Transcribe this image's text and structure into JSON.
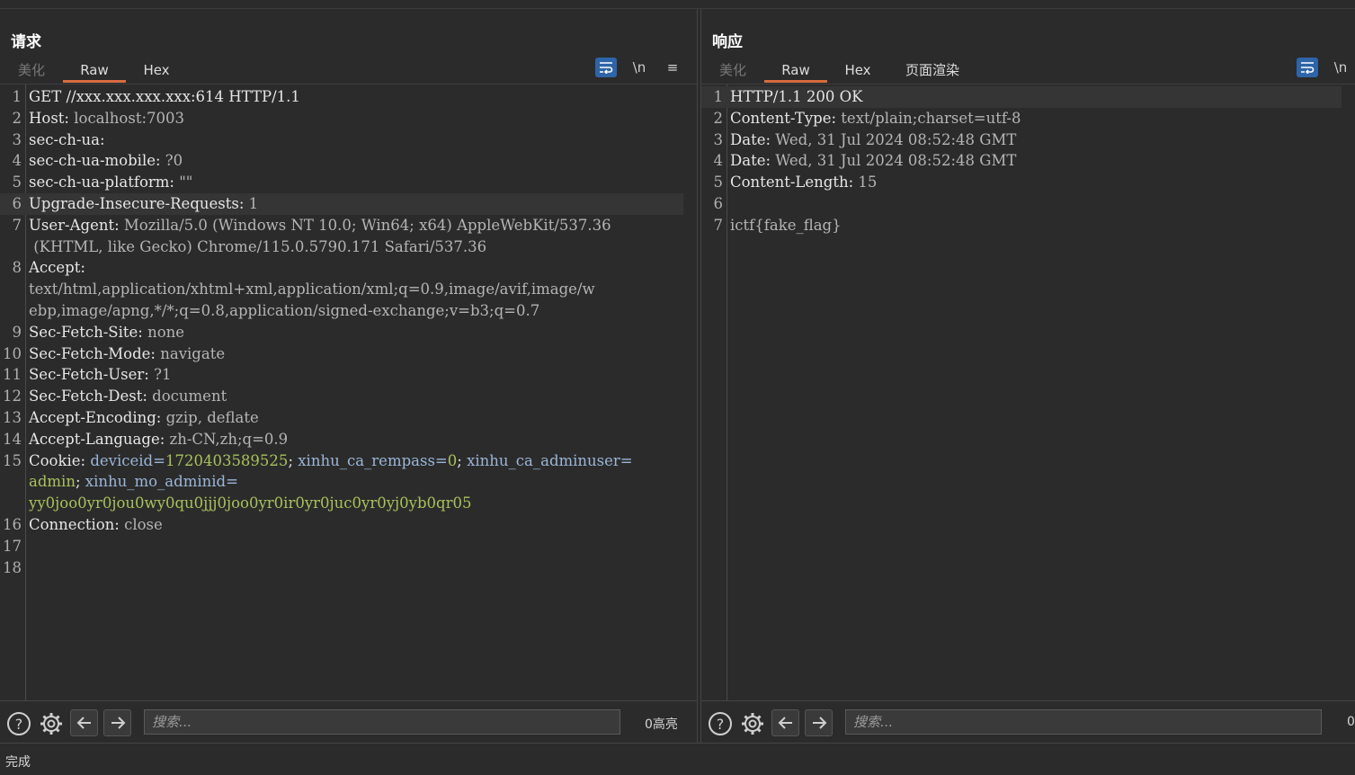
{
  "request": {
    "title": "请求",
    "tabs": [
      "美化",
      "Raw",
      "Hex"
    ],
    "toolbar": {
      "newline": "\\n",
      "menu": "≡"
    },
    "lines": [
      {
        "n": "1",
        "k": "GET //xxx.xxx.xxx.xxx:614 HTTP/1.1",
        "v": ""
      },
      {
        "n": "2",
        "k": "Host: ",
        "v": "localhost:7003"
      },
      {
        "n": "3",
        "k": "sec-ch-ua:",
        "v": ""
      },
      {
        "n": "4",
        "k": "sec-ch-ua-mobile: ",
        "v": "?0"
      },
      {
        "n": "5",
        "k": "sec-ch-ua-platform: ",
        "v": "\"\""
      },
      {
        "n": "6",
        "k": "Upgrade-Insecure-Requests: ",
        "v": "1"
      },
      {
        "n": "7",
        "k": "User-Agent: ",
        "v": "Mozilla/5.0 (Windows NT 10.0; Win64; x64) AppleWebKit/537.36"
      },
      {
        "n": "",
        "k": "",
        "v": " (KHTML, like Gecko) Chrome/115.0.5790.171 Safari/537.36"
      },
      {
        "n": "8",
        "k": "Accept:",
        "v": ""
      },
      {
        "n": "",
        "k": "",
        "v": "text/html,application/xhtml+xml,application/xml;q=0.9,image/avif,image/w"
      },
      {
        "n": "",
        "k": "",
        "v": "ebp,image/apng,*/*;q=0.8,application/signed-exchange;v=b3;q=0.7"
      },
      {
        "n": "9",
        "k": "Sec-Fetch-Site: ",
        "v": "none"
      },
      {
        "n": "10",
        "k": "Sec-Fetch-Mode: ",
        "v": "navigate"
      },
      {
        "n": "11",
        "k": "Sec-Fetch-User: ",
        "v": "?1"
      },
      {
        "n": "12",
        "k": "Sec-Fetch-Dest: ",
        "v": "document"
      },
      {
        "n": "13",
        "k": "Accept-Encoding: ",
        "v": "gzip, deflate"
      },
      {
        "n": "14",
        "k": "Accept-Language: ",
        "v": "zh-CN,zh;q=0.9"
      },
      {
        "n": "15",
        "cookie": [
          [
            "k",
            "Cookie: "
          ],
          [
            "ck",
            "deviceid="
          ],
          [
            "cv",
            "1720403589525"
          ],
          [
            "k",
            "; "
          ],
          [
            "ck",
            "xinhu_ca_rempass="
          ],
          [
            "cv",
            "0"
          ],
          [
            "k",
            "; "
          ],
          [
            "ck",
            "xinhu_ca_adminuser="
          ]
        ]
      },
      {
        "n": "",
        "cookie": [
          [
            "cv",
            "admin"
          ],
          [
            "k",
            "; "
          ],
          [
            "ck",
            "xinhu_mo_adminid="
          ]
        ]
      },
      {
        "n": "",
        "cookie": [
          [
            "cv",
            "yy0joo0yr0jou0wy0qu0jjj0joo0yr0ir0yr0juc0yr0yj0yb0qr05"
          ]
        ]
      },
      {
        "n": "16",
        "k": "Connection: ",
        "v": "close"
      },
      {
        "n": "17",
        "k": "",
        "v": ""
      },
      {
        "n": "18",
        "k": "",
        "v": ""
      }
    ],
    "search_placeholder": "搜索...",
    "highlight_count": "0高亮"
  },
  "response": {
    "title": "响应",
    "tabs": [
      "美化",
      "Raw",
      "Hex",
      "页面渲染"
    ],
    "toolbar": {
      "newline": "\\n"
    },
    "lines": [
      {
        "n": "1",
        "k": "HTTP/1.1 200 OK",
        "v": ""
      },
      {
        "n": "2",
        "k": "Content-Type: ",
        "v": "text/plain;charset=utf-8"
      },
      {
        "n": "3",
        "k": "Date: ",
        "v": "Wed, 31 Jul 2024 08:52:48 GMT"
      },
      {
        "n": "4",
        "k": "Date: ",
        "v": "Wed, 31 Jul 2024 08:52:48 GMT"
      },
      {
        "n": "5",
        "k": "Content-Length: ",
        "v": "15"
      },
      {
        "n": "6",
        "k": "",
        "v": ""
      },
      {
        "n": "7",
        "k": "",
        "v": "ictf{fake_flag}"
      }
    ],
    "search_placeholder": "搜索...",
    "highlight_count": "0"
  },
  "status": "完成",
  "colors": {
    "accent_tab": "#d86c3f",
    "toggle_blue": "#2e64a8",
    "cookie_value": "#a8c25c",
    "cookie_key": "#9bb6d8"
  }
}
